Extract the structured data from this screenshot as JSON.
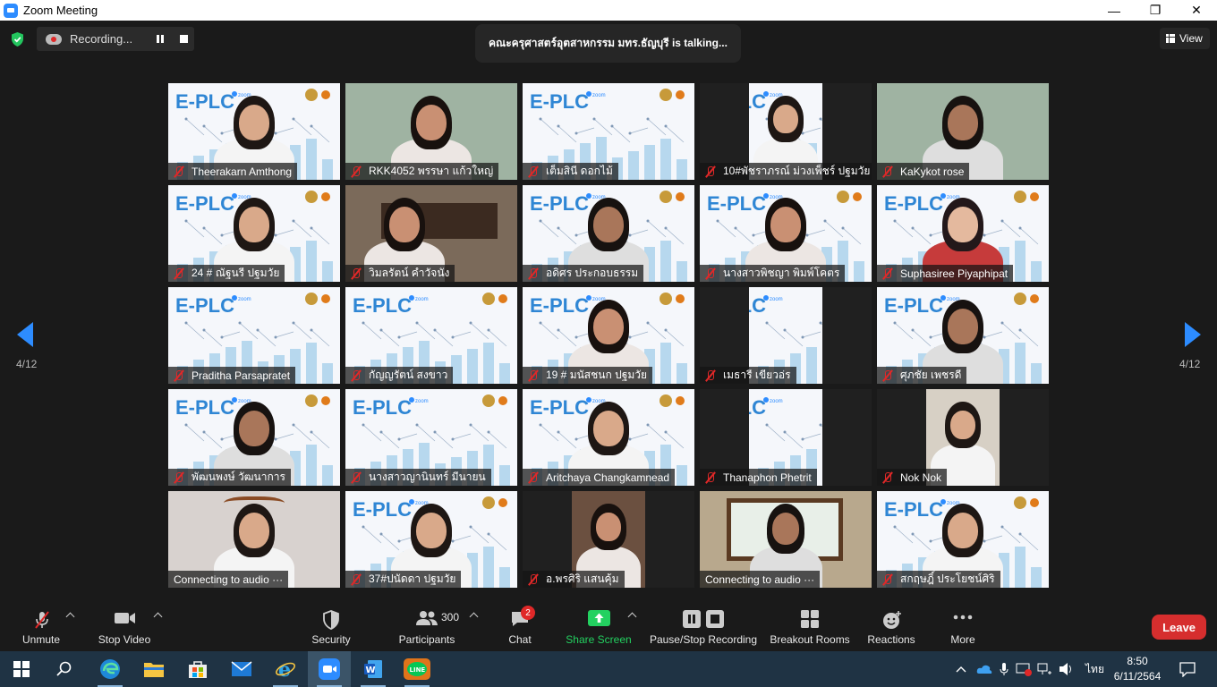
{
  "window": {
    "title": "Zoom Meeting",
    "controls": [
      "—",
      "❐",
      "✕"
    ]
  },
  "header": {
    "recording_label": "Recording...",
    "talking_text": "คณะครุศาสตร์อุตสาหกรรม มทร.ธัญบุรี is  talking...",
    "view_label": "View"
  },
  "pagination": {
    "left": "4/12",
    "right": "4/12"
  },
  "participants": [
    {
      "name": "Theerakarn Amthong",
      "muted": true
    },
    {
      "name": "RKK4052 พรรษา แก้วใหญ่",
      "muted": true
    },
    {
      "name": "เต็มสินี ดอกไม้",
      "muted": true
    },
    {
      "name": "10#พัชราภรณ์ ม่วงเพ็ชร์ ปฐมวัย",
      "muted": true
    },
    {
      "name": "KaKykot rose",
      "muted": true
    },
    {
      "name": "24 # ณัฐนรี ปฐมวัย",
      "muted": true
    },
    {
      "name": "วิมลรัตน์ คำวัจนัง",
      "muted": true
    },
    {
      "name": "อดิศร ประกอบธรรม",
      "muted": true
    },
    {
      "name": "นางสาวพิชญา พิมพ์โคตร",
      "muted": true
    },
    {
      "name": "Suphasiree Piyaphipat",
      "muted": true
    },
    {
      "name": "Praditha Parsapratet",
      "muted": true
    },
    {
      "name": "กัญญรัตน์ สงขาว",
      "muted": true
    },
    {
      "name": "19 # มนัสชนก ปฐมวัย",
      "muted": true
    },
    {
      "name": "เมธารี เขียวอ่ร",
      "muted": true
    },
    {
      "name": "ศุภชัย เพชรดี",
      "muted": true
    },
    {
      "name": "พัฒนพงษ์ วัฒนาการ",
      "muted": true
    },
    {
      "name": "นางสาวญานินทร์ มีนายน",
      "muted": true
    },
    {
      "name": "Aritchaya Changkamnead",
      "muted": true
    },
    {
      "name": "Thanaphon Phetrit",
      "muted": true
    },
    {
      "name": "Nok Nok",
      "muted": true
    },
    {
      "name": "Connecting to audio ···",
      "muted": false
    },
    {
      "name": "37#ปนัดดา ปฐมวัย",
      "muted": true
    },
    {
      "name": "อ.พรศิริ แสนคุ้ม",
      "muted": true
    },
    {
      "name": "Connecting to audio ···",
      "muted": false
    },
    {
      "name": "สกฤษฎิ์ ประโยชน์ศิริ",
      "muted": true
    }
  ],
  "toolbar": {
    "unmute": "Unmute",
    "stop_video": "Stop Video",
    "security": "Security",
    "participants": "Participants",
    "participants_count": "300",
    "chat": "Chat",
    "chat_badge": "2",
    "share_screen": "Share Screen",
    "pause_stop_recording": "Pause/Stop Recording",
    "breakout_rooms": "Breakout Rooms",
    "reactions": "Reactions",
    "more": "More",
    "leave": "Leave"
  },
  "taskbar": {
    "apps": [
      "start",
      "search",
      "edge",
      "file-explorer",
      "store",
      "mail",
      "internet-explorer",
      "zoom",
      "word",
      "line"
    ],
    "line_label": "LINE",
    "language": "ไทย",
    "time": "8:50",
    "date": "6/11/2564"
  },
  "colors": {
    "accent": "#2d8cff",
    "leave": "#d62e2e",
    "share": "#23d160",
    "mute": "#e02828",
    "taskbar": "#1f3344"
  }
}
